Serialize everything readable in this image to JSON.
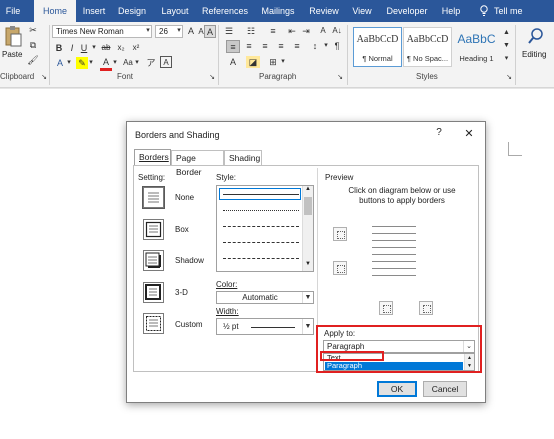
{
  "ribbon": {
    "tabs": [
      "File",
      "Home",
      "Insert",
      "Design",
      "Layout",
      "References",
      "Mailings",
      "Review",
      "View",
      "Developer",
      "Help",
      "Tell me"
    ],
    "active_tab": "Home",
    "font_name": "Times New Roman",
    "font_size": "26",
    "paste_label": "Paste",
    "groups": {
      "clipboard": "Clipboard",
      "font": "Font",
      "paragraph": "Paragraph",
      "styles": "Styles"
    },
    "styles": [
      {
        "sample": "AaBbCcD",
        "name": "¶ Normal"
      },
      {
        "sample": "AaBbCcD",
        "name": "¶ No Spac..."
      },
      {
        "sample": "AaBbC",
        "name": "Heading 1"
      }
    ],
    "editing_label": "Editing"
  },
  "dialog": {
    "title": "Borders and Shading",
    "help": "?",
    "close": "✕",
    "tabs": [
      "Borders",
      "Page Border",
      "Shading"
    ],
    "setting_label": "Setting:",
    "settings": [
      "None",
      "Box",
      "Shadow",
      "3-D",
      "Custom"
    ],
    "style_label": "Style:",
    "color_label": "Color:",
    "color_value": "Automatic",
    "width_label": "Width:",
    "width_value": "½ pt",
    "preview_label": "Preview",
    "preview_hint": "Click on diagram below or use buttons to apply borders",
    "apply_to_label": "Apply to:",
    "apply_to_value": "Paragraph",
    "apply_options": [
      "Text",
      "Paragraph"
    ],
    "ok": "OK",
    "cancel": "Cancel"
  },
  "colors": {
    "ribbon_blue": "#2b579a",
    "highlight_red": "#e02020",
    "selection_blue": "#0078d7"
  }
}
